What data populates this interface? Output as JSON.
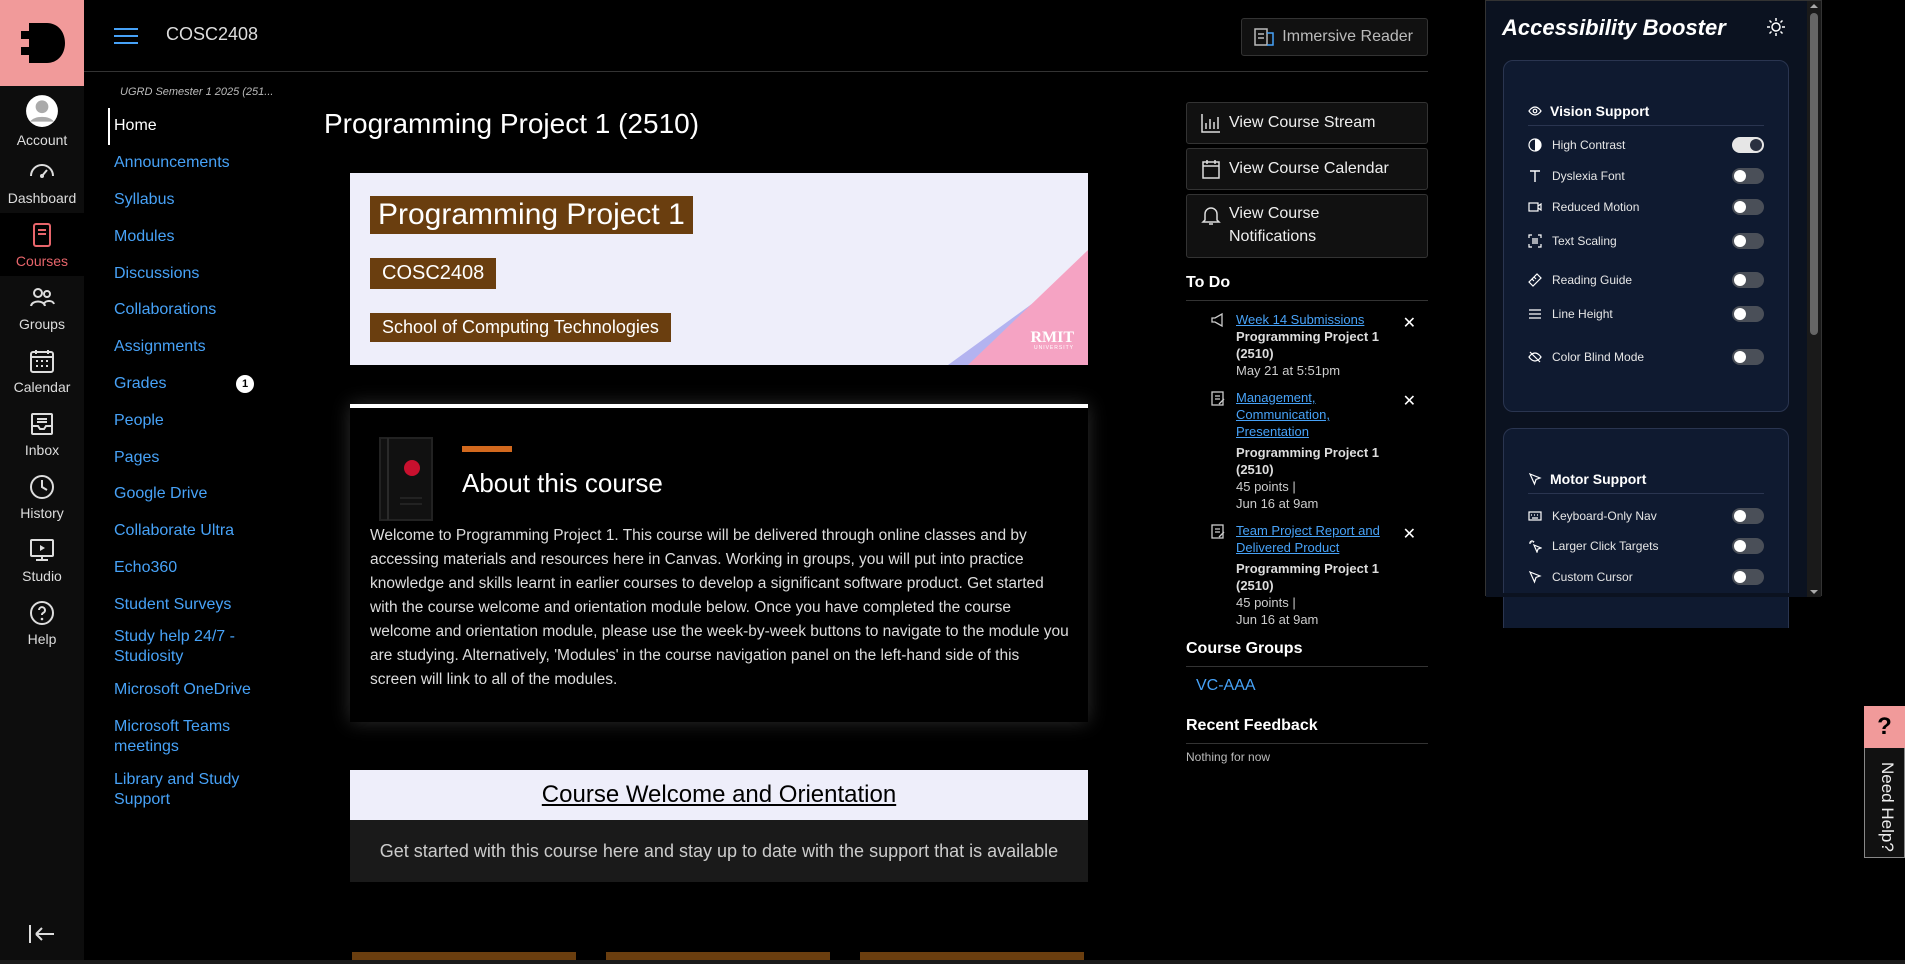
{
  "header": {
    "course_code": "COSC2408",
    "immersive_reader": "Immersive Reader"
  },
  "global_nav": [
    {
      "label": "Account",
      "icon": "account-icon"
    },
    {
      "label": "Dashboard",
      "icon": "dashboard-icon"
    },
    {
      "label": "Courses",
      "icon": "courses-icon",
      "active": true
    },
    {
      "label": "Groups",
      "icon": "groups-icon"
    },
    {
      "label": "Calendar",
      "icon": "calendar-icon"
    },
    {
      "label": "Inbox",
      "icon": "inbox-icon"
    },
    {
      "label": "History",
      "icon": "history-icon"
    },
    {
      "label": "Studio",
      "icon": "studio-icon"
    },
    {
      "label": "Help",
      "icon": "help-icon"
    }
  ],
  "course_nav": {
    "term": "UGRD Semester 1 2025 (251...",
    "items": [
      "Home",
      "Announcements",
      "Syllabus",
      "Modules",
      "Discussions",
      "Collaborations",
      "Assignments",
      "Grades",
      "People",
      "Pages",
      "Google Drive",
      "Collaborate Ultra",
      "Echo360",
      "Student Surveys",
      "Study help 24/7 - Studiosity",
      "Microsoft OneDrive",
      "Microsoft Teams meetings",
      "Library and Study Support"
    ],
    "grades_badge": "1"
  },
  "main": {
    "title": "Programming Project 1 (2510)",
    "banner": {
      "title": "Programming Project 1",
      "code": "COSC2408",
      "school": "School of Computing Technologies",
      "logo": "RMIT",
      "logo_sub": "UNIVERSITY"
    },
    "about": {
      "heading": "About this course",
      "text": "Welcome to Programming Project 1.   This course will be delivered through online classes and by accessing materials and resources here in Canvas.  Working in groups, you will put into practice knowledge and skills learnt in earlier courses to develop a significant software product.  Get started with the course welcome and orientation module below. Once you have completed the course welcome and orientation  module, please  use the week-by-week buttons  to navigate to the module you are studying. Alternatively, 'Modules' in the course navigation panel on the left-hand side of this screen will link to all of the modules."
    },
    "welcome": {
      "heading": "Course Welcome and Orientation",
      "text": "Get started with this course here and stay up to date with the support that is available"
    }
  },
  "sidebar": {
    "buttons": [
      "View Course Stream",
      "View Course Calendar",
      "View Course Notifications"
    ],
    "todo_title": "To Do",
    "todo": [
      {
        "title": "Week 14 Submissions",
        "course": "Programming Project 1 (2510)",
        "meta1": "May 21 at 5:51pm",
        "meta2": ""
      },
      {
        "title": "Management, Communication, Presentation",
        "course": "Programming Project 1 (2510)",
        "meta1": "45 points  |",
        "meta2": "Jun 16 at 9am"
      },
      {
        "title": "Team Project Report and Delivered Product",
        "course": "Programming Project 1 (2510)",
        "meta1": "45 points  |",
        "meta2": "Jun 16 at 9am"
      }
    ],
    "groups_title": "Course Groups",
    "group": "VC-AAA",
    "feedback_title": "Recent Feedback",
    "feedback_text": "Nothing for now"
  },
  "accessibility": {
    "title": "Accessibility Booster",
    "vision_title": "Vision Support",
    "vision": [
      {
        "label": "High Contrast",
        "on": true
      },
      {
        "label": "Dyslexia Font",
        "on": false
      },
      {
        "label": "Reduced Motion",
        "on": false
      },
      {
        "label": "Text Scaling",
        "on": false
      },
      {
        "label": "Reading Guide",
        "on": false
      },
      {
        "label": "Line Height",
        "on": false
      },
      {
        "label": "Color Blind Mode",
        "on": false
      }
    ],
    "motor_title": "Motor Support",
    "motor": [
      {
        "label": "Keyboard-Only Nav",
        "on": false
      },
      {
        "label": "Larger Click Targets",
        "on": false
      },
      {
        "label": "Custom Cursor",
        "on": false
      }
    ]
  },
  "need_help": {
    "q": "?",
    "label": "Need Help?"
  },
  "colors": {
    "accent": "#47a2f7",
    "brand": "#f19a9a",
    "banner_brown": "#6a3e0f"
  }
}
